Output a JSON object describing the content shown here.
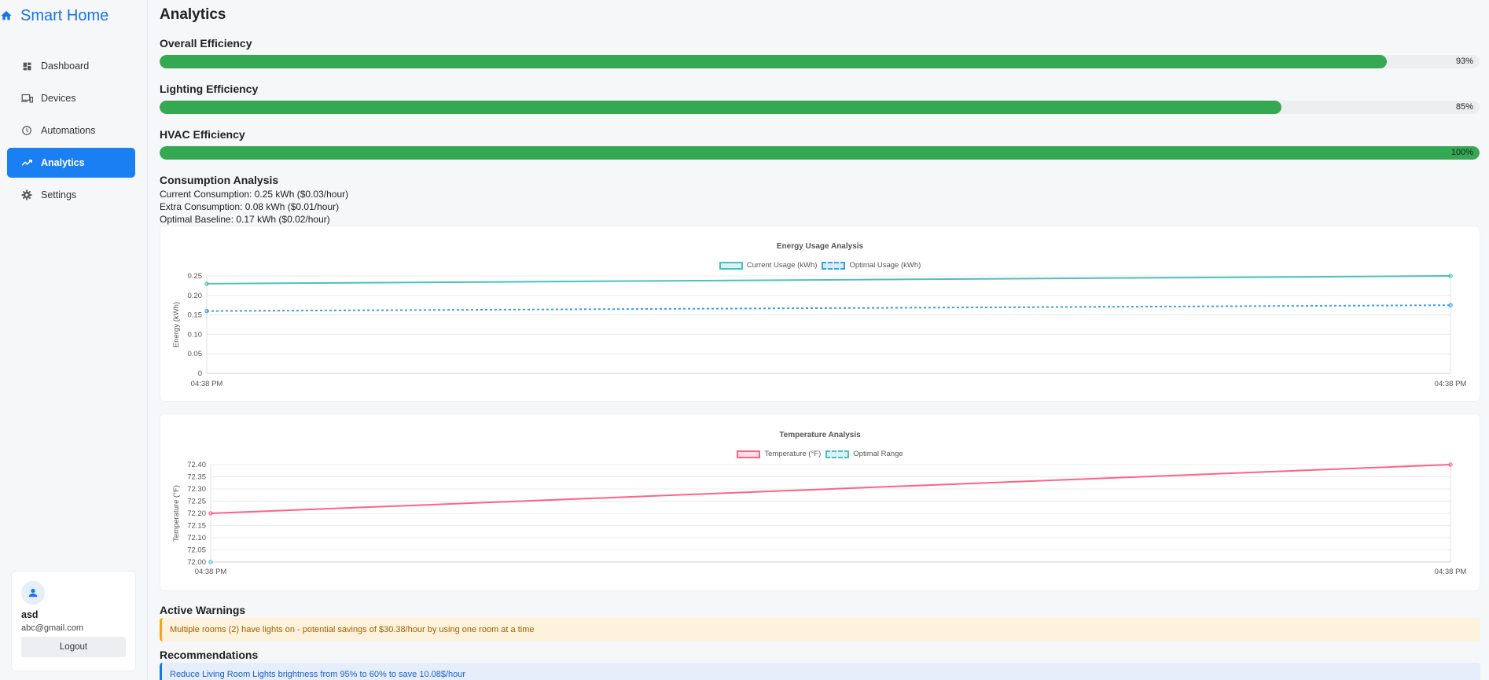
{
  "app": {
    "title": "Smart Home"
  },
  "nav": [
    {
      "label": "Dashboard",
      "icon": "dashboard-icon"
    },
    {
      "label": "Devices",
      "icon": "devices-icon"
    },
    {
      "label": "Automations",
      "icon": "clock-icon"
    },
    {
      "label": "Analytics",
      "icon": "analytics-icon",
      "active": true
    },
    {
      "label": "Settings",
      "icon": "gear-icon"
    }
  ],
  "user": {
    "name": "asd",
    "email": "abc@gmail.com",
    "logout_label": "Logout"
  },
  "page": {
    "title": "Analytics"
  },
  "efficiency": [
    {
      "title": "Overall Efficiency",
      "value": 93,
      "label": "93%"
    },
    {
      "title": "Lighting Efficiency",
      "value": 85,
      "label": "85%"
    },
    {
      "title": "HVAC Efficiency",
      "value": 100,
      "label": "100%"
    }
  ],
  "consumption": {
    "title": "Consumption Analysis",
    "lines": [
      "Current Consumption: 0.25 kWh ($0.03/hour)",
      "Extra Consumption: 0.08 kWh ($0.01/hour)",
      "Optimal Baseline: 0.17 kWh ($0.02/hour)"
    ]
  },
  "colors": {
    "accent": "#1a7ff2",
    "bar": "#34a853",
    "current": "#4bc0c0",
    "optimal": "#36a2eb",
    "temp": "#ff6384"
  },
  "chart_data": [
    {
      "type": "line",
      "title": "Energy Usage Analysis",
      "xlabel": "",
      "ylabel": "Energy (kWh)",
      "x": [
        "04:38 PM",
        "04:38 PM"
      ],
      "ylim": [
        0,
        0.25
      ],
      "yticks": [
        "0",
        "0.05",
        "0.10",
        "0.15",
        "0.20",
        "0.25"
      ],
      "grid": true,
      "legend_position": "top",
      "series": [
        {
          "name": "Current Usage (kWh)",
          "values": [
            0.23,
            0.25
          ]
        },
        {
          "name": "Optimal Usage (kWh)",
          "values": [
            0.16,
            0.175
          ]
        }
      ]
    },
    {
      "type": "line",
      "title": "Temperature Analysis",
      "xlabel": "",
      "ylabel": "Temperature (°F)",
      "x": [
        "04:38 PM",
        "04:38 PM"
      ],
      "ylim": [
        72.0,
        72.4
      ],
      "yticks": [
        "72.00",
        "72.05",
        "72.10",
        "72.15",
        "72.20",
        "72.25",
        "72.30",
        "72.35",
        "72.40"
      ],
      "grid": true,
      "legend_position": "top",
      "series": [
        {
          "name": "Temperature (°F)",
          "values": [
            72.2,
            72.4
          ]
        },
        {
          "name": "Optimal Range",
          "values": [
            72.0
          ]
        }
      ]
    }
  ],
  "warnings": {
    "title": "Active Warnings",
    "items": [
      "Multiple rooms (2) have lights on - potential savings of $30.38/hour by using one room at a time"
    ]
  },
  "recommendations": {
    "title": "Recommendations",
    "items": [
      "Reduce Living Room Lights brightness from 95% to 60% to save 10.08$/hour"
    ]
  }
}
